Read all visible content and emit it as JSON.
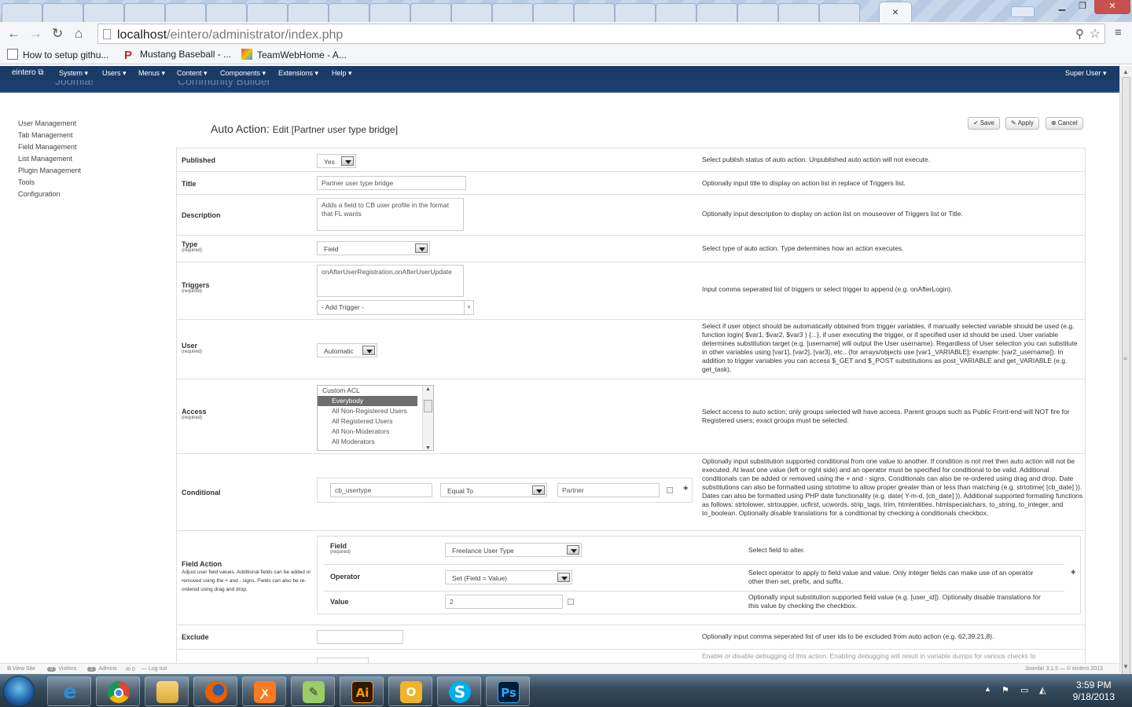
{
  "browser": {
    "tab_close": "×",
    "url_host": "localhost",
    "url_path": "/eintero/administrator/index.php",
    "bookmarks": [
      {
        "label": "How to setup githu..."
      },
      {
        "label": "Mustang Baseball - ..."
      },
      {
        "label": "TeamWebHome - A..."
      }
    ]
  },
  "joomla": {
    "site_name": "eintero",
    "menus": [
      "System",
      "Users",
      "Menus",
      "Content",
      "Components",
      "Extensions",
      "Help"
    ],
    "user_menu": "Super User",
    "header_ghost_left": "Joomla!",
    "header_ghost_right": "Community Builder"
  },
  "sidebar": {
    "items": [
      "User Management",
      "Tab Management",
      "Field Management",
      "List Management",
      "Plugin Management",
      "Tools",
      "Configuration"
    ]
  },
  "page": {
    "title": "Auto Action:",
    "subtitle": "Edit [Partner user type bridge]",
    "save_label": "Save",
    "apply_label": "Apply",
    "cancel_label": "Cancel"
  },
  "form": {
    "required_text": "(required)",
    "published": {
      "label": "Published",
      "value": "Yes",
      "desc": "Select publish status of auto action. Unpublished auto action will not execute."
    },
    "title": {
      "label": "Title",
      "value": "Partner user type bridge",
      "desc": "Optionally input title to display on action list in replace of Triggers list."
    },
    "description": {
      "label": "Description",
      "value": "Adds a field to CB user profile in the format that FL wants",
      "desc": "Optionally input description to display on action list on mouseover of Triggers list or Title."
    },
    "type": {
      "label": "Type",
      "value": "Field",
      "desc": "Select type of auto action. Type determines how an action executes."
    },
    "triggers": {
      "label": "Triggers",
      "value": "onAfterUserRegistration,onAfterUserUpdate",
      "add_placeholder": "- Add Trigger -",
      "desc": "Input comma seperated list of triggers or select trigger to append (e.g. onAfterLogin)."
    },
    "user": {
      "label": "User",
      "value": "Automatic",
      "desc": "Select if user object should be automatically obtained from trigger variables, if manually selected variable should be used (e.g. function login( $var1, $var2, $var3 ) {...}, if user executing the trigger, or if specified user id should be used. User variable determines substitution target (e.g. [username] will output the User username). Regardless of User selection you can substitute in other variables using [var1], [var2], [var3], etc.. (for arrays/objects use [var1_VARIABLE]; example: [var2_username]). In addition to trigger variables you can access $_GET and $_POST substitutions as post_VARIABLE and get_VARIABLE (e.g. get_task)."
    },
    "access": {
      "label": "Access",
      "options": [
        "Custom ACL",
        "Everybody",
        "All Non-Registered Users",
        "All Registered Users",
        "All Non-Moderators",
        "All Moderators"
      ],
      "selected": "Everybody",
      "desc": "Select access to auto action; only groups selected will have access. Parent groups such as Public Front-end will NOT fire for Registered users; exact groups must be selected."
    },
    "conditional": {
      "label": "Conditional",
      "field": "cb_usertype",
      "operator": "Equal To",
      "value": "Partner",
      "add": "+",
      "desc": "Optionally input substitution supported conditional from one value to another. If condition is not met then auto action will not be executed. At least one value (left or right side) and an operator must be specified for conditional to be valid. Additional conditionals can be added or removed using the + and - signs. Conditionals can also be re-ordered using drag and drop. Date substitutions can also be formatted using strtotime to allow proper greater than or less than matching (e.g. strtotime( [cb_date] )). Dates can also be formatted using PHP date functionality (e.g. date( Y-m-d, [cb_date] )). Additional supported formating functions as follows: strtolower, strtoupper, ucfirst, ucwords, strip_tags, trim, htmlentities, htmlspecialchars, to_string, to_integer, and to_boolean. Optionally disable translations for a conditional by checking a conditionals checkbox."
    },
    "field_action": {
      "label": "Field Action",
      "help": "Adjust user field values. Additional fields can be added or removed using the + and - signs. Fields can also be re-ordered using drag and drop.",
      "add": "+",
      "field_label": "Field",
      "field_value": "Freelance User Type",
      "field_desc": "Select field to alter.",
      "operator_label": "Operator",
      "operator_value": "Set (Field = Value)",
      "operator_desc": "Select operator to apply to field value and value. Only integer fields can make use of an operator other then set, prefix, and suffix.",
      "value_label": "Value",
      "value_value": "2",
      "value_desc": "Optionally input substitution supported field value (e.g. [user_id]). Optionally disable translations for this value by checking the checkbox."
    },
    "exclude": {
      "label": "Exclude",
      "value": "",
      "desc": "Optionally input comma seperated list of user ids to be excluded from auto action (e.g. 62,39,21,8)."
    },
    "debug": {
      "desc": "Enable or disable debugging of this action. Enabling debugging will result in variable dumps for various checks to"
    }
  },
  "status": {
    "view_site": "View Site",
    "visitors_count": "0",
    "visitors": "Visitors",
    "admins_count": "1",
    "admins": "Admins",
    "messages_count": "0",
    "logout": "Log out",
    "version": "Joomla! 3.1.5 — © eintero 2013"
  },
  "taskbar": {
    "apps": [
      "internet-explorer",
      "chrome",
      "file-explorer",
      "firefox",
      "xampp",
      "notepad-plus",
      "illustrator",
      "outlook",
      "skype",
      "photoshop"
    ],
    "time": "3:59 PM",
    "date": "9/18/2013"
  },
  "colors": {
    "joomla_nav": "#1b3a66",
    "taskbar": "#34495b"
  }
}
